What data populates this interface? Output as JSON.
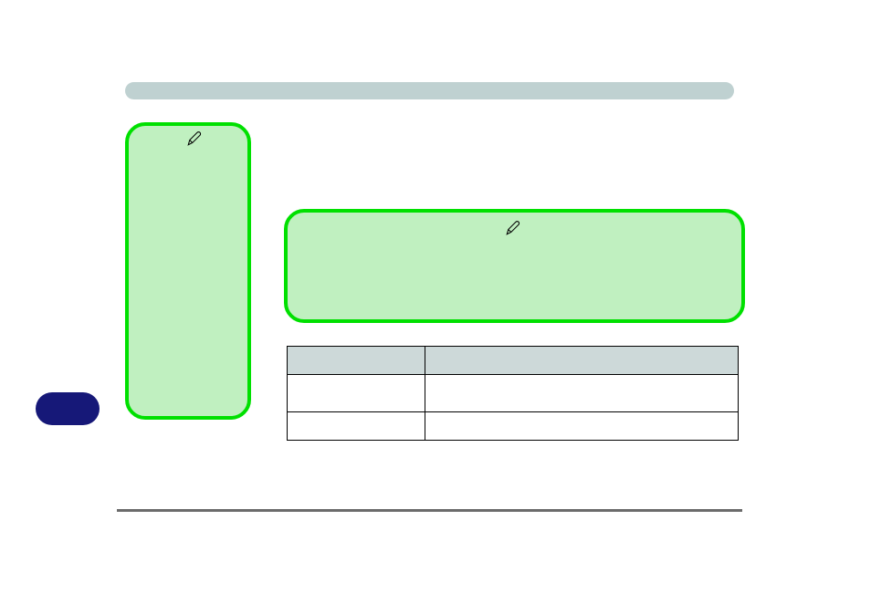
{
  "top_bar": {
    "label": ""
  },
  "green_left": {
    "label": "",
    "icon": "pen-icon"
  },
  "green_right": {
    "label": "",
    "icon": "pen-icon"
  },
  "navy_pill": {
    "label": ""
  },
  "table": {
    "headers": [
      "",
      ""
    ],
    "rows": [
      [
        "",
        ""
      ],
      [
        "",
        ""
      ]
    ]
  }
}
